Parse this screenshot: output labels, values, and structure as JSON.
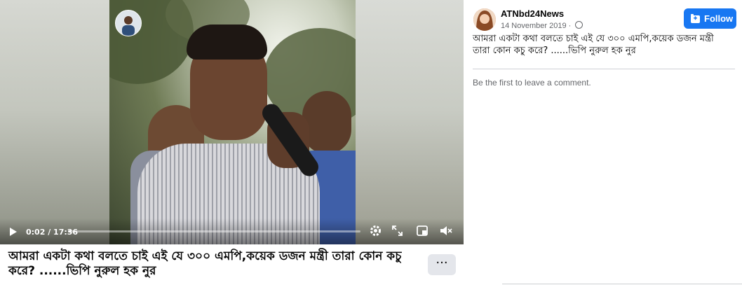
{
  "post": {
    "caption": "আমরা একটা কথা বলতে চাই এই যে ৩০০ এমপি,কয়েক ডজন মন্ত্রী তারা কোন কচু করে? ......ভিপি নুরুল হক নুর",
    "more_label": "···"
  },
  "video": {
    "time_label": "0:02 / 17:36",
    "progress_fraction": 0.002,
    "icons": {
      "play": "play-icon",
      "settings": "gear-icon",
      "fullscreen": "expand-icon",
      "pip": "picture-in-picture-icon",
      "volume": "volume-muted-icon"
    }
  },
  "sidebar": {
    "page_name": "ATNbd24News",
    "date": "14 November 2019 · ",
    "follow_label": "Follow",
    "post_text": "আমরা একটা কথা বলতে চাই এই যে ৩০০ এমপি,কয়েক ডজন মন্ত্রী তারা কোন কচু করে? ......ভিপি নুরুল হক নুর",
    "empty_comments": "Be the first to leave a comment."
  },
  "colors": {
    "accent": "#1877f2",
    "secondary_text": "#65676b"
  }
}
